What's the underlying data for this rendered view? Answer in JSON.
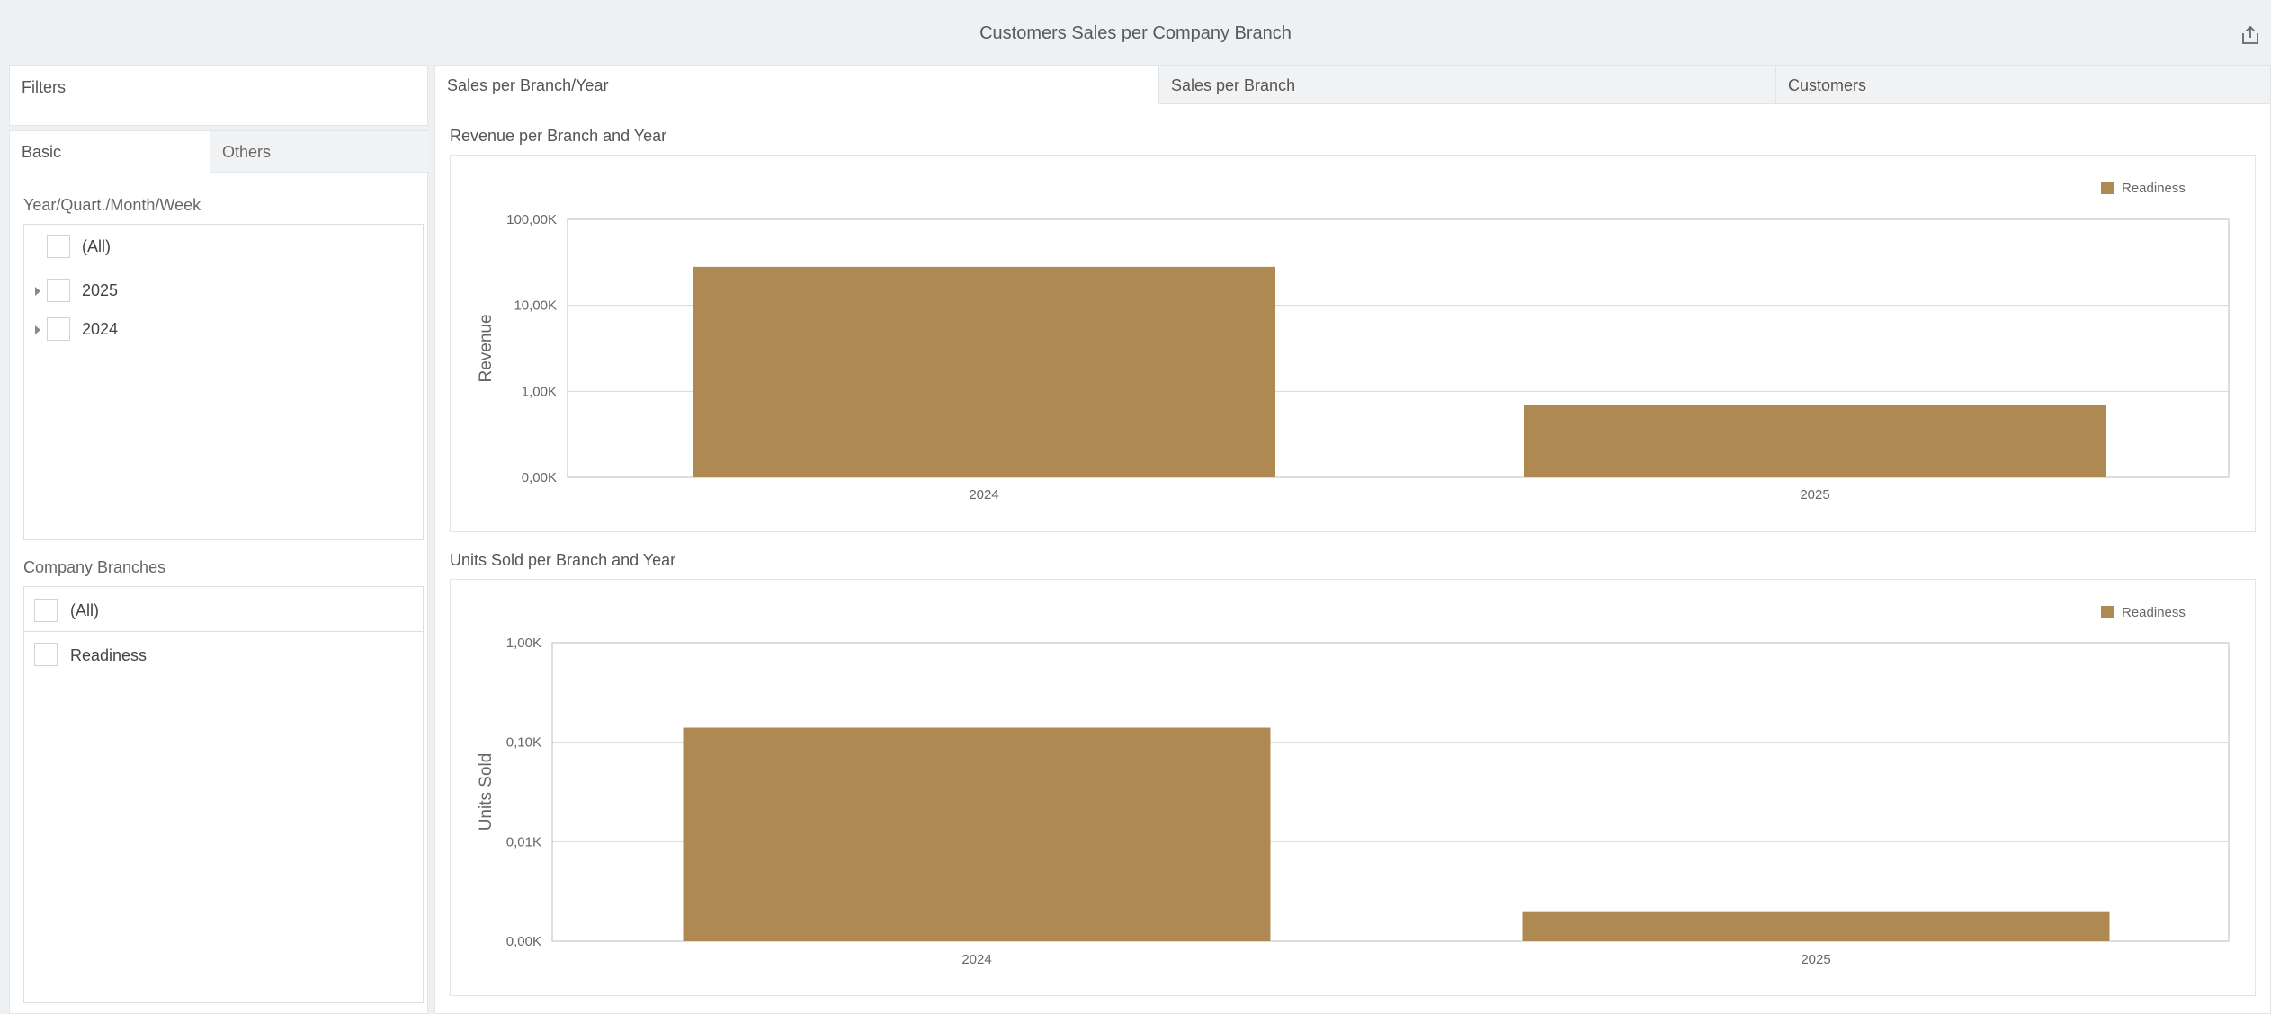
{
  "header": {
    "title": "Customers Sales per Company Branch",
    "export_icon": "share-export-icon"
  },
  "filters": {
    "title": "Filters",
    "tabs": [
      {
        "label": "Basic",
        "active": true
      },
      {
        "label": "Others",
        "active": false
      }
    ],
    "date_filter": {
      "label": "Year/Quart./Month/Week",
      "items": [
        {
          "label": "(All)",
          "expandable": false,
          "checked": false
        },
        {
          "label": "2025",
          "expandable": true,
          "checked": false
        },
        {
          "label": "2024",
          "expandable": true,
          "checked": false
        }
      ]
    },
    "branches_filter": {
      "label": "Company Branches",
      "items": [
        {
          "label": "(All)",
          "checked": false
        },
        {
          "label": "Readiness",
          "checked": false
        }
      ]
    }
  },
  "main": {
    "tabs": [
      {
        "label": "Sales per Branch/Year",
        "active": true
      },
      {
        "label": "Sales per Branch",
        "active": false
      },
      {
        "label": "Customers",
        "active": false
      }
    ]
  },
  "colors": {
    "bar": "#ae8a52",
    "grid": "#d8d8d8",
    "axis": "#bdbdbd"
  },
  "chart_data": [
    {
      "type": "bar",
      "title": "Revenue per Branch and Year",
      "categories": [
        "2024",
        "2025"
      ],
      "series": [
        {
          "name": "Readiness",
          "values": [
            28000,
            700
          ]
        }
      ],
      "xlabel": "",
      "ylabel": "Revenue",
      "yscale": "log",
      "yticks": [
        {
          "value": 100,
          "label": "0,00K"
        },
        {
          "value": 1000,
          "label": "1,00K"
        },
        {
          "value": 10000,
          "label": "10,00K"
        },
        {
          "value": 100000,
          "label": "100,00K"
        }
      ],
      "ylim": [
        100,
        100000
      ],
      "grid": true,
      "legend": "top-right"
    },
    {
      "type": "bar",
      "title": "Units Sold per Branch and Year",
      "categories": [
        "2024",
        "2025"
      ],
      "series": [
        {
          "name": "Readiness",
          "values": [
            140,
            2
          ]
        }
      ],
      "xlabel": "",
      "ylabel": "Units Sold",
      "yscale": "log",
      "yticks": [
        {
          "value": 1,
          "label": "0,00K"
        },
        {
          "value": 10,
          "label": "0,01K"
        },
        {
          "value": 100,
          "label": "0,10K"
        },
        {
          "value": 1000,
          "label": "1,00K"
        }
      ],
      "ylim": [
        1,
        1000
      ],
      "grid": true,
      "legend": "top-right"
    }
  ]
}
